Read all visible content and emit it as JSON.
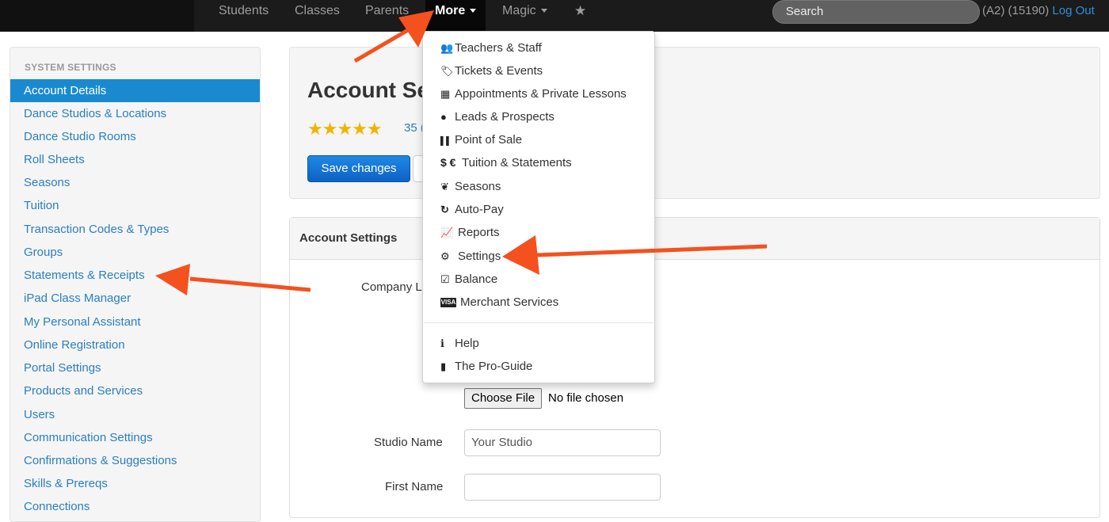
{
  "nav": {
    "items": [
      {
        "label": "Students"
      },
      {
        "label": "Classes"
      },
      {
        "label": "Parents"
      },
      {
        "label": "More"
      },
      {
        "label": "Magic"
      },
      {
        "label": "★"
      }
    ],
    "search_placeholder": "Search",
    "account_code": "(A2) (15190)",
    "logout_label": "Log Out"
  },
  "sidebar": {
    "header": "SYSTEM SETTINGS",
    "items": [
      {
        "label": "Account Details"
      },
      {
        "label": "Dance Studios & Locations"
      },
      {
        "label": "Dance Studio Rooms"
      },
      {
        "label": "Roll Sheets"
      },
      {
        "label": "Seasons"
      },
      {
        "label": "Tuition"
      },
      {
        "label": "Transaction Codes & Types"
      },
      {
        "label": "Groups"
      },
      {
        "label": "Statements & Receipts"
      },
      {
        "label": "iPad Class Manager"
      },
      {
        "label": "My Personal Assistant"
      },
      {
        "label": "Online Registration"
      },
      {
        "label": "Portal Settings"
      },
      {
        "label": "Products and Services"
      },
      {
        "label": "Users"
      },
      {
        "label": "Communication Settings"
      },
      {
        "label": "Confirmations & Suggestions"
      },
      {
        "label": "Skills & Prereqs"
      },
      {
        "label": "Connections"
      }
    ]
  },
  "hero": {
    "title": "Account Se",
    "stars": "★★★★★",
    "rating_text": "35 (",
    "save_label": "Save changes"
  },
  "panel": {
    "heading": "Account Settings",
    "company_label": "Company L",
    "choose_file_label": "Choose File",
    "no_file_text": "No file chosen",
    "studio_name_label": "Studio Name",
    "studio_name_value": "Your Studio",
    "first_name_label": "First Name",
    "first_name_value": ""
  },
  "dropdown": {
    "items": [
      {
        "icon": "users-icon",
        "glyph": "👥",
        "label": "Teachers & Staff"
      },
      {
        "icon": "ticket-icon",
        "glyph": "🏷",
        "label": "Tickets & Events"
      },
      {
        "icon": "calendar-icon",
        "glyph": "▦",
        "label": "Appointments & Private Lessons"
      },
      {
        "icon": "map-marker-icon",
        "glyph": "●",
        "label": "Leads & Prospects"
      },
      {
        "icon": "barcode-icon",
        "glyph": "▌▌",
        "label": "Point of Sale"
      },
      {
        "icon": "currency-icon",
        "glyph": "$ €",
        "label": "Tuition & Statements"
      },
      {
        "icon": "leaf-icon",
        "glyph": "❦",
        "label": "Seasons"
      },
      {
        "icon": "refresh-icon",
        "glyph": "↻",
        "label": "Auto-Pay"
      },
      {
        "icon": "line-chart-icon",
        "glyph": "📈",
        "label": "Reports"
      },
      {
        "icon": "gears-icon",
        "glyph": "⚙",
        "label": "Settings"
      },
      {
        "icon": "check-square-icon",
        "glyph": "☑",
        "label": "Balance"
      },
      {
        "icon": "visa-card-icon",
        "glyph": "VISA",
        "label": "Merchant Services"
      },
      {
        "icon": "info-circle-icon",
        "glyph": "ℹ",
        "label": "Help"
      },
      {
        "icon": "book-icon",
        "glyph": "▮",
        "label": "The Pro-Guide"
      }
    ]
  },
  "colors": {
    "accent": "#1a8ad0",
    "link": "#2a7fc0",
    "annotation_arrow": "#f4511e"
  }
}
